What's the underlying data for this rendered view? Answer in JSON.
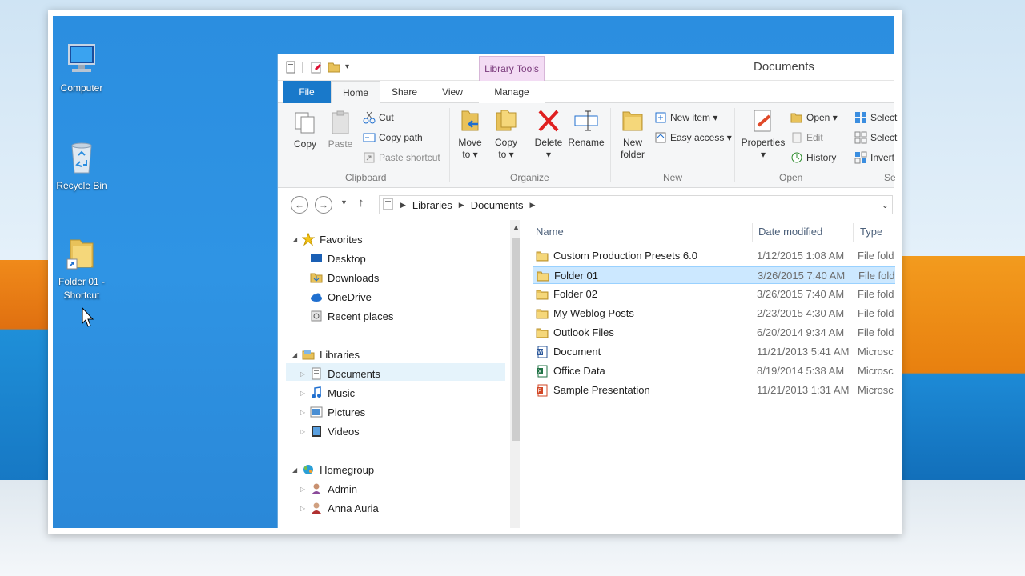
{
  "desktop": {
    "icons": [
      {
        "label": "Computer",
        "icon": "computer-icon"
      },
      {
        "label": "Recycle Bin",
        "icon": "recycle-bin-icon"
      },
      {
        "label": "Folder 01 -",
        "label2": "Shortcut",
        "icon": "folder-shortcut-icon"
      }
    ]
  },
  "window": {
    "title": "Documents",
    "context_tab": "Library Tools",
    "tabs": [
      "File",
      "Home",
      "Share",
      "View",
      "Manage"
    ],
    "ribbon": {
      "clipboard": {
        "copy": "Copy",
        "paste": "Paste",
        "cut": "Cut",
        "copy_path": "Copy path",
        "paste_shortcut": "Paste shortcut",
        "label": "Clipboard"
      },
      "organize": {
        "move_to": "Move",
        "move_to2": "to ▾",
        "copy_to": "Copy",
        "copy_to2": "to ▾",
        "delete": "Delete",
        "delete2": "▾",
        "rename": "Rename",
        "label": "Organize"
      },
      "new": {
        "new_folder": "New",
        "new_folder2": "folder",
        "new_item": "New item ▾",
        "easy_access": "Easy access ▾",
        "label": "New"
      },
      "open": {
        "properties": "Properties",
        "properties2": "▾",
        "open": "Open ▾",
        "edit": "Edit",
        "history": "History",
        "label": "Open"
      },
      "select": {
        "select_all": "Select",
        "select_none": "Select",
        "invert": "Invert",
        "label": "Se"
      }
    },
    "address": {
      "crumbs": [
        "Libraries",
        "Documents"
      ]
    },
    "nav": {
      "favorites": "Favorites",
      "favorites_items": [
        "Desktop",
        "Downloads",
        "OneDrive",
        "Recent places"
      ],
      "libraries": "Libraries",
      "libraries_items": [
        "Documents",
        "Music",
        "Pictures",
        "Videos"
      ],
      "homegroup": "Homegroup",
      "homegroup_items": [
        "Admin",
        "Anna Auria"
      ]
    },
    "columns": {
      "name": "Name",
      "date": "Date modified",
      "type": "Type"
    },
    "files": [
      {
        "name": "Custom Production Presets 6.0",
        "date": "1/12/2015 1:08 AM",
        "type": "File fold",
        "kind": "folder"
      },
      {
        "name": "Folder 01",
        "date": "3/26/2015 7:40 AM",
        "type": "File fold",
        "kind": "folder"
      },
      {
        "name": "Folder 02",
        "date": "3/26/2015 7:40 AM",
        "type": "File fold",
        "kind": "folder"
      },
      {
        "name": "My Weblog Posts",
        "date": "2/23/2015 4:30 AM",
        "type": "File fold",
        "kind": "folder"
      },
      {
        "name": "Outlook Files",
        "date": "6/20/2014 9:34 AM",
        "type": "File fold",
        "kind": "folder"
      },
      {
        "name": "Document",
        "date": "11/21/2013 5:41 AM",
        "type": "Microsc",
        "kind": "word"
      },
      {
        "name": "Office Data",
        "date": "8/19/2014 5:38 AM",
        "type": "Microsc",
        "kind": "excel"
      },
      {
        "name": "Sample Presentation",
        "date": "11/21/2013 1:31 AM",
        "type": "Microsc",
        "kind": "powerpoint"
      }
    ]
  },
  "colors": {
    "accent": "#1979ca",
    "desktop": "#2f94e4",
    "selection": "#cce8ff",
    "context_tab": "#f3dcf4"
  }
}
